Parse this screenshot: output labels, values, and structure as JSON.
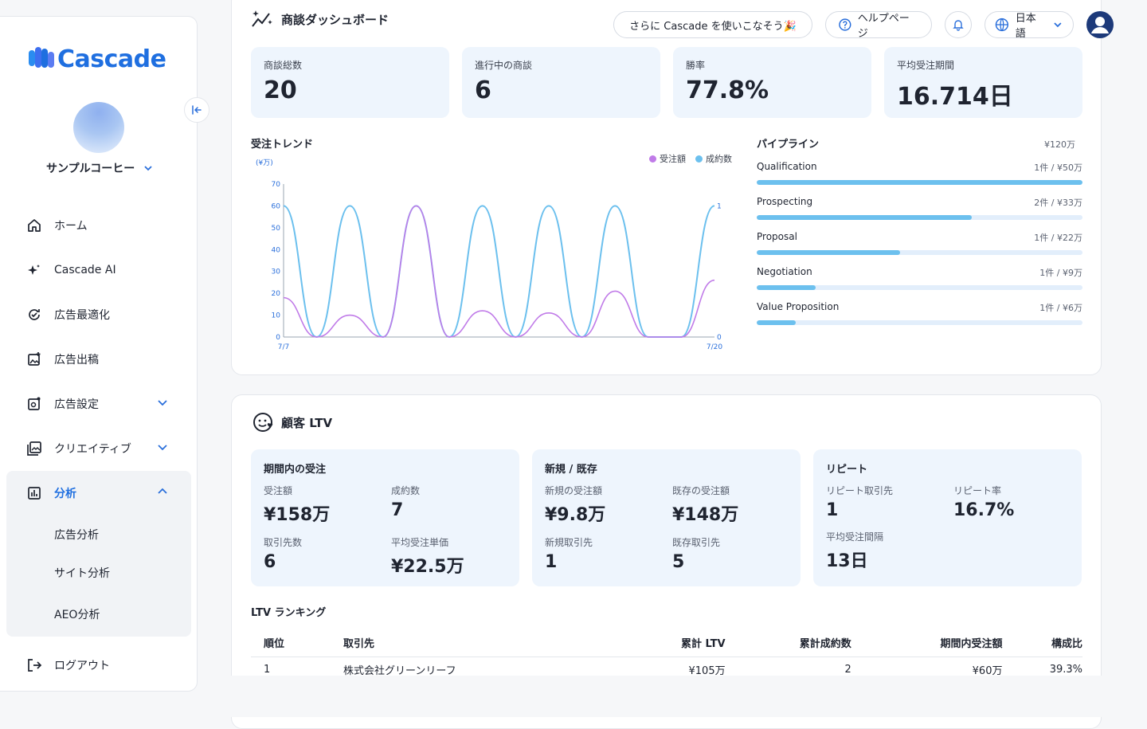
{
  "brand": {
    "name": "Cascade",
    "accent": "#1f6fe0"
  },
  "org": {
    "name": "サンプルコーヒー"
  },
  "nav": {
    "items": [
      {
        "label": "ホーム",
        "icon": "home-icon"
      },
      {
        "label": "Cascade AI",
        "icon": "sparkle-icon"
      },
      {
        "label": "広告最適化",
        "icon": "refresh-check-icon"
      },
      {
        "label": "広告出稿",
        "icon": "image-plus-icon"
      },
      {
        "label": "広告設定",
        "icon": "image-gear-icon"
      },
      {
        "label": "クリエイティブ",
        "icon": "gallery-icon"
      },
      {
        "label": "分析",
        "icon": "chart-box-icon"
      }
    ],
    "sub_items": [
      "広告分析",
      "サイト分析",
      "AEO分析"
    ],
    "logout": "ログアウト"
  },
  "topbar": {
    "promo": "さらに Cascade を使いこなそう🎉",
    "help": "ヘルプページ",
    "language": "日本語"
  },
  "deals": {
    "title": "商談ダッシュボード",
    "kpis": [
      {
        "label": "商談総数",
        "value": "20"
      },
      {
        "label": "進行中の商談",
        "value": "6"
      },
      {
        "label": "勝率",
        "value": "77.8%"
      },
      {
        "label": "平均受注期間",
        "value": "16.714日"
      }
    ],
    "trend_title": "受注トレンド",
    "pipeline": {
      "title": "パイプライン",
      "total": "¥120万",
      "rows": [
        {
          "stage": "Qualification",
          "amount": "1件 / ¥50万",
          "share": 1.0
        },
        {
          "stage": "Prospecting",
          "amount": "2件 / ¥33万",
          "share": 0.66
        },
        {
          "stage": "Proposal",
          "amount": "1件 / ¥22万",
          "share": 0.44
        },
        {
          "stage": "Negotiation",
          "amount": "1件 / ¥9万",
          "share": 0.18
        },
        {
          "stage": "Value Proposition",
          "amount": "1件 / ¥6万",
          "share": 0.12
        }
      ]
    }
  },
  "chart_data": {
    "type": "line",
    "ylabel": "(¥万)",
    "x_start": "7/7",
    "x_end": "7/20",
    "ylim": [
      0,
      70
    ],
    "yticks": [
      0,
      10,
      20,
      30,
      40,
      50,
      60,
      70
    ],
    "y2ticks": [
      0,
      1
    ],
    "legend": "top-right",
    "series": [
      {
        "name": "受注額",
        "color": "#c07be8",
        "values": [
          18,
          0,
          10,
          0,
          60,
          0,
          12,
          0,
          11,
          0,
          21,
          0,
          0,
          26
        ]
      },
      {
        "name": "成約数",
        "color": "#6cc0ee",
        "values": [
          1,
          0,
          1,
          0,
          1,
          0,
          1,
          0,
          1,
          0,
          1,
          0,
          0,
          1
        ]
      }
    ]
  },
  "ltv": {
    "title": "顧客 LTV",
    "boxes": [
      {
        "heading": "期間内の受注",
        "items": [
          {
            "label": "受注額",
            "value": "¥158万"
          },
          {
            "label": "成約数",
            "value": "7"
          },
          {
            "label": "取引先数",
            "value": "6"
          },
          {
            "label": "平均受注単価",
            "value": "¥22.5万"
          }
        ]
      },
      {
        "heading": "新規 / 既存",
        "items": [
          {
            "label": "新規の受注額",
            "value": "¥9.8万"
          },
          {
            "label": "既存の受注額",
            "value": "¥148万"
          },
          {
            "label": "新規取引先",
            "value": "1"
          },
          {
            "label": "既存取引先",
            "value": "5"
          }
        ]
      },
      {
        "heading": "リピート",
        "items": [
          {
            "label": "リピート取引先",
            "value": "1"
          },
          {
            "label": "リピート率",
            "value": "16.7%"
          },
          {
            "label": "平均受注間隔",
            "value": "13日"
          }
        ]
      }
    ],
    "ranking_title": "LTV ランキング",
    "ranking_headers": [
      "順位",
      "取引先",
      "累計 LTV",
      "累計成約数",
      "期間内受注額",
      "構成比"
    ],
    "ranking_rows": [
      [
        "1",
        "株式会社グリーンリーフ",
        "¥105万",
        "2",
        "¥60万",
        "39.3%"
      ]
    ]
  }
}
